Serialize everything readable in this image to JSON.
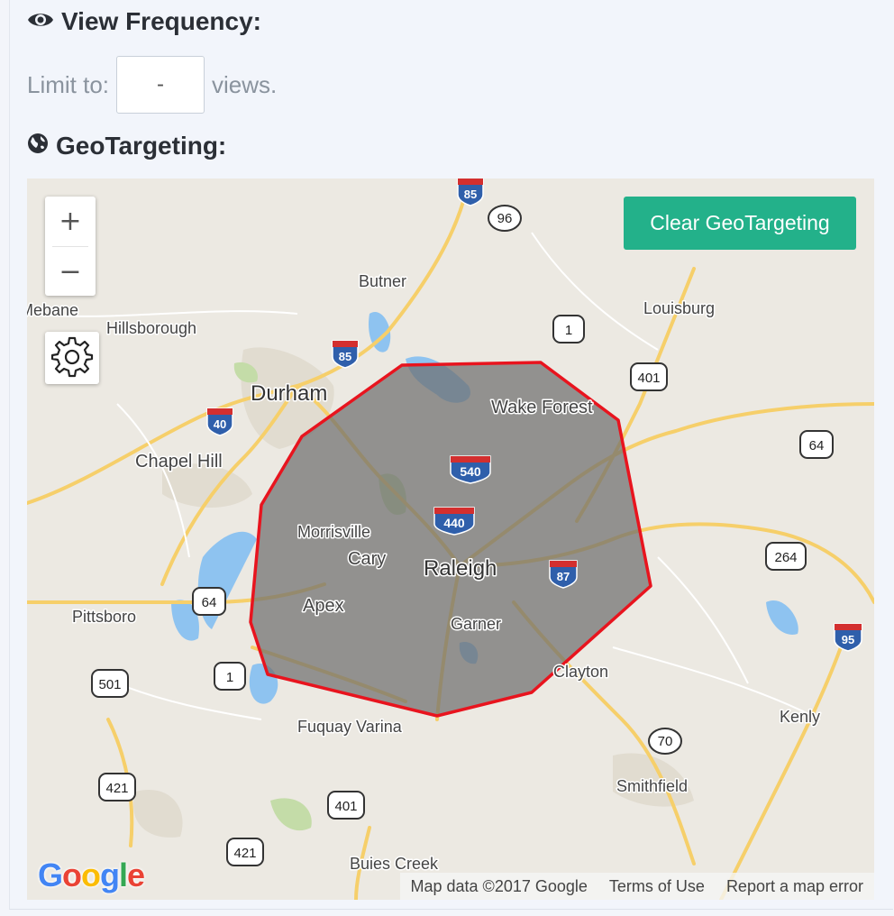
{
  "view_frequency": {
    "title": "View Frequency:",
    "limit_label": "Limit to:",
    "limit_value": "-",
    "limit_suffix": "views.",
    "icon": "eye-icon"
  },
  "geotargeting": {
    "title": "GeoTargeting:",
    "icon": "globe-icon",
    "clear_button": "Clear GeoTargeting"
  },
  "map": {
    "zoom_in": "+",
    "zoom_out": "−",
    "settings_icon": "gear-icon",
    "logo": "Google",
    "attribution": {
      "map_data": "Map data ©2017 Google",
      "terms": "Terms of Use",
      "report": "Report a map error"
    },
    "polygon_stroke": "#e8141e",
    "polygon_fill": "#6f6f6f",
    "cities": {
      "durham": "Durham",
      "raleigh": "Raleigh",
      "chapel_hill": "Chapel Hill",
      "cary": "Cary",
      "morrisville": "Morrisville",
      "apex": "Apex",
      "garner": "Garner",
      "wake_forest": "Wake Forest",
      "butner": "Butner",
      "hillsborough": "Hillsborough",
      "mebane": "Mebane",
      "louisburg": "Louisburg",
      "pittsboro": "Pittsboro",
      "fuquay_varina": "Fuquay Varina",
      "clayton": "Clayton",
      "kenly": "Kenly",
      "smithfield": "Smithfield",
      "buies_creek": "Buies Creek"
    },
    "shields": {
      "i85_top": "85",
      "i85_mid": "85",
      "i40": "40",
      "i540": "540",
      "i440": "440",
      "i87": "87",
      "i95": "95",
      "us1_top": "1",
      "us1_bottom": "1",
      "nc96": "96",
      "us401_top": "401",
      "us401_bottom": "401",
      "us64_right": "64",
      "us64_left": "64",
      "us264": "264",
      "us501": "501",
      "us421_left": "421",
      "us421_bottom": "421",
      "nc70": "70"
    }
  }
}
